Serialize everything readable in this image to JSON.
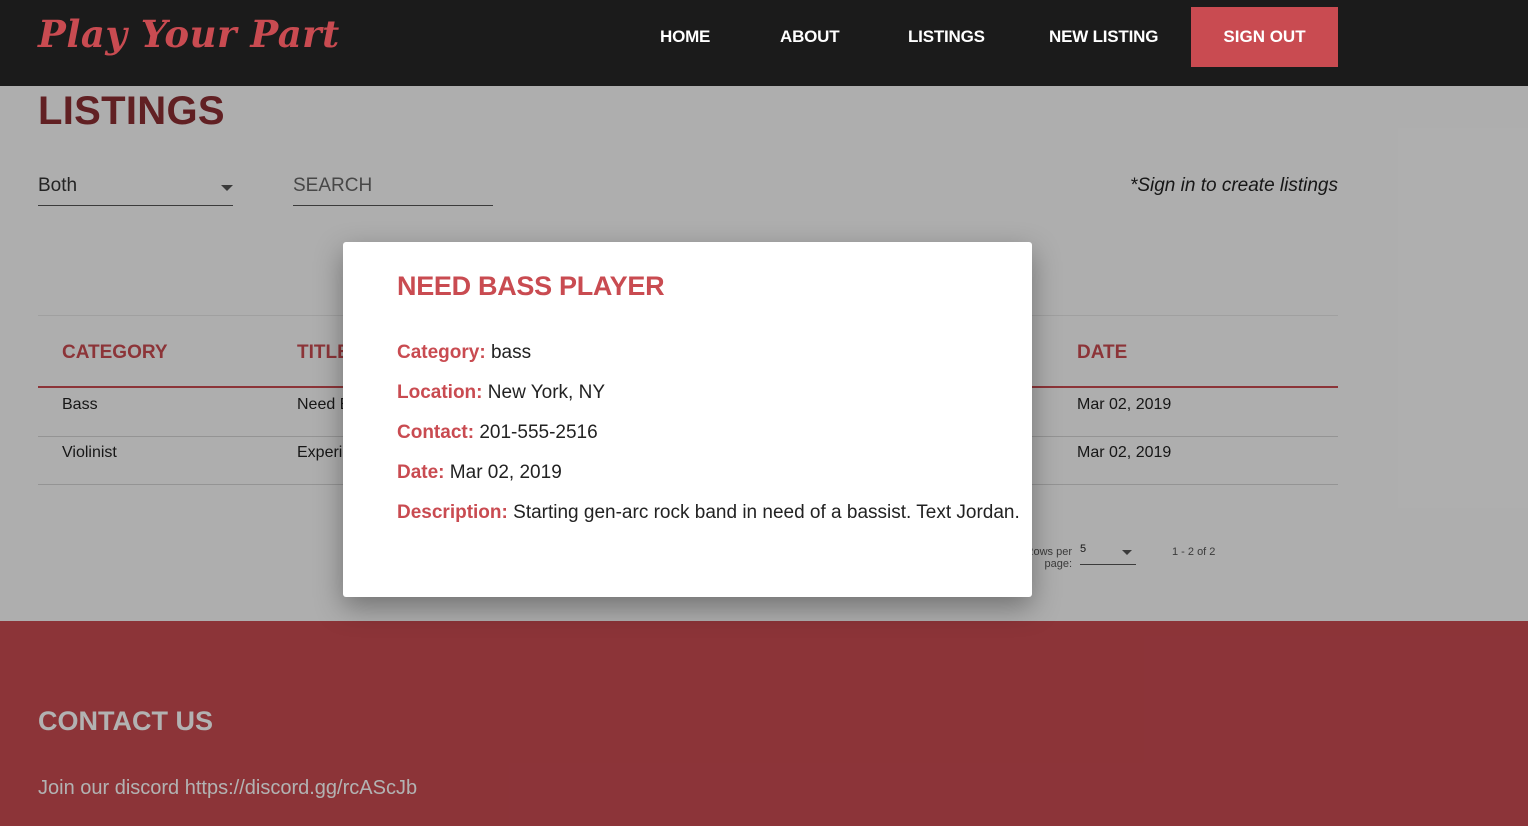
{
  "header": {
    "logo": "Play Your Part",
    "nav": [
      "HOME",
      "ABOUT",
      "LISTINGS",
      "NEW LISTING"
    ],
    "signout": "SIGN OUT"
  },
  "page": {
    "title": "LISTINGS",
    "filter_value": "Both",
    "search_placeholder": "SEARCH",
    "signin_note": "*Sign in to create listings"
  },
  "table": {
    "headers": [
      "CATEGORY",
      "TITLE",
      "DATE"
    ],
    "rows": [
      {
        "category": "Bass",
        "title": "Need Bass Player",
        "date": "Mar 02, 2019"
      },
      {
        "category": "Violinist",
        "title": "Experienced Violinist",
        "date": "Mar 02, 2019"
      }
    ]
  },
  "pagination": {
    "rows_label": "Rows per page:",
    "rows_value": "5",
    "range": "1 - 2 of 2"
  },
  "footer": {
    "title": "CONTACT US",
    "text": "Join our discord https://discord.gg/rcAScJb"
  },
  "modal": {
    "title": "NEED BASS PLAYER",
    "fields": [
      {
        "label": "Category:",
        "value": "bass"
      },
      {
        "label": "Location:",
        "value": "New York, NY"
      },
      {
        "label": "Contact:",
        "value": "201-555-2516"
      },
      {
        "label": "Date:",
        "value": "Mar 02, 2019"
      },
      {
        "label": "Description:",
        "value": "Starting gen-arc rock band in need of a bassist. Text Jordan."
      }
    ]
  }
}
